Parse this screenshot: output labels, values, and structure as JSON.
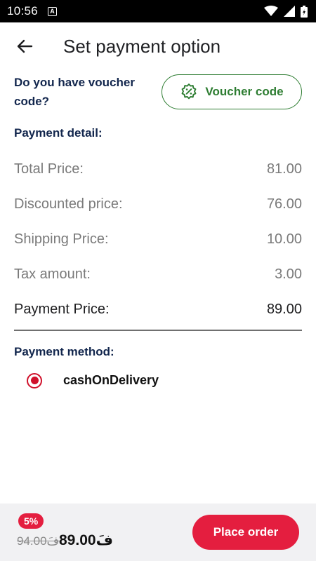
{
  "status_bar": {
    "time": "10:56",
    "notification_icon_letter": "A",
    "icons": [
      "wifi-icon",
      "signal-icon",
      "battery-icon"
    ]
  },
  "app_bar": {
    "back_icon": "arrow-left-icon",
    "title": "Set payment option"
  },
  "voucher": {
    "question": "Do you have voucher code?",
    "button_label": "Voucher code",
    "button_icon": "discount-badge-icon"
  },
  "payment_detail": {
    "heading": "Payment detail:",
    "rows": [
      {
        "label": "Total Price:",
        "value": "81.00"
      },
      {
        "label": "Discounted price:",
        "value": "76.00"
      },
      {
        "label": "Shipping Price:",
        "value": "10.00"
      },
      {
        "label": "Tax amount:",
        "value": "3.00"
      }
    ],
    "total": {
      "label": "Payment Price:",
      "value": "89.00"
    }
  },
  "payment_method": {
    "heading": "Payment method:",
    "option": "cashOnDelivery",
    "selected": true
  },
  "footer": {
    "discount_badge": "5%",
    "old_price": "94.00فَ",
    "new_price": "89.00فَ",
    "place_order_label": "Place order"
  },
  "colors": {
    "accent_red": "#e41e3f",
    "radio_red": "#d0112b",
    "voucher_green": "#2e7d32",
    "heading_navy": "#12264d"
  }
}
